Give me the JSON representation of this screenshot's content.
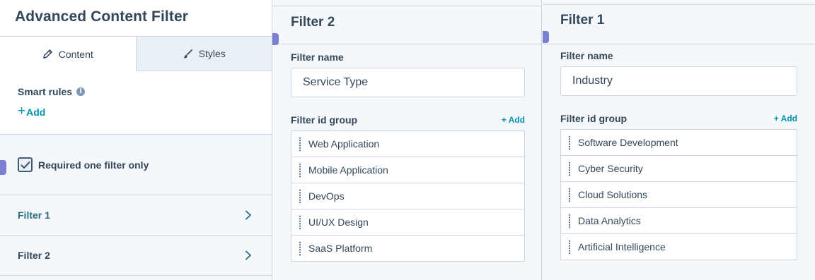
{
  "sidebar": {
    "title": "Advanced Content Filter",
    "tabs": [
      {
        "label": "Content",
        "icon": "pencil-icon",
        "active": true
      },
      {
        "label": "Styles",
        "icon": "brush-icon",
        "active": false
      }
    ],
    "smart_rules": {
      "label": "Smart rules",
      "add_label": "Add"
    },
    "required": {
      "label": "Required one filter only",
      "checked": true
    },
    "filters": [
      {
        "label": "Filter 1"
      },
      {
        "label": "Filter 2"
      }
    ]
  },
  "panels": {
    "filter2": {
      "title": "Filter 2",
      "name_label": "Filter name",
      "name_value": "Service Type",
      "group_label": "Filter id group",
      "add_label": "+ Add",
      "items": [
        "Web Application",
        "Mobile Application",
        "DevOps",
        "UI/UX Design",
        "SaaS Platform"
      ]
    },
    "filter1": {
      "title": "Filter 1",
      "name_label": "Filter name",
      "name_value": "Industry",
      "group_label": "Filter id group",
      "add_label": "+ Add",
      "items": [
        "Software Development",
        "Cyber Security",
        "Cloud Solutions",
        "Data Analytics",
        "Artificial Intelligence"
      ]
    }
  },
  "colors": {
    "accent": "#0091ae",
    "text": "#33475b",
    "border": "#cbd6e2",
    "marker": "#7b7fd1"
  }
}
